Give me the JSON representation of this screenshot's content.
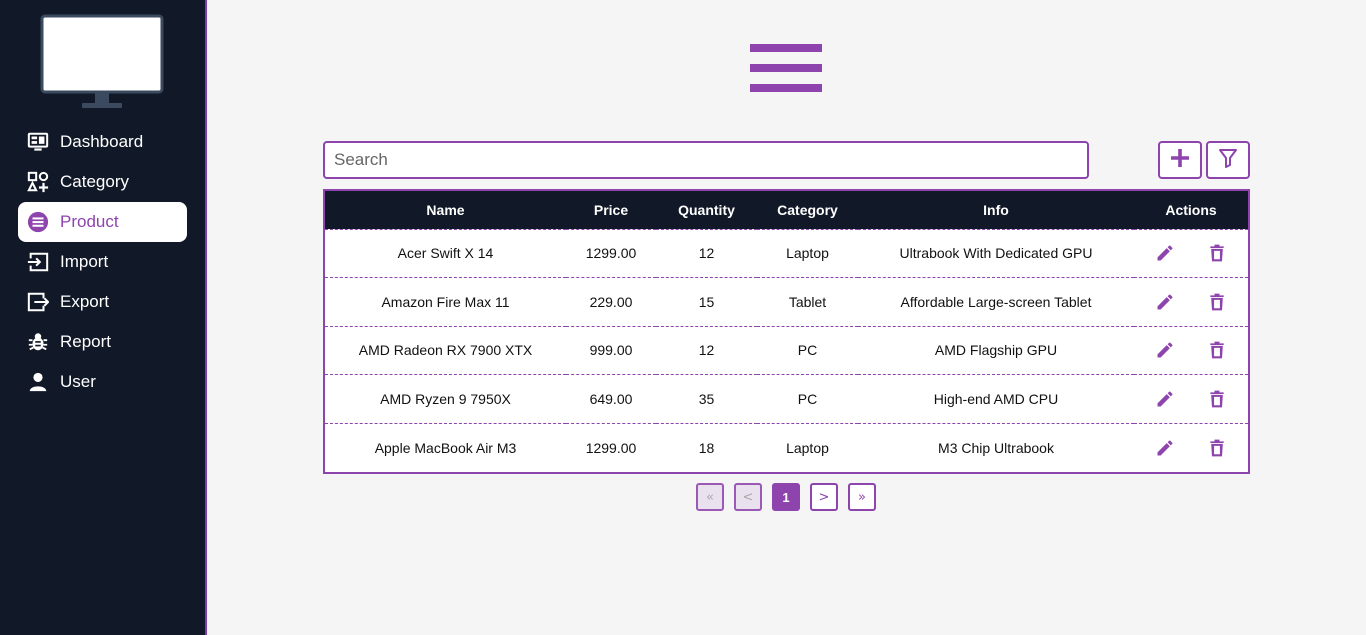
{
  "sidebar": {
    "items": [
      {
        "label": "Dashboard",
        "icon": "dashboard-icon"
      },
      {
        "label": "Category",
        "icon": "category-icon"
      },
      {
        "label": "Product",
        "icon": "product-icon",
        "active": true
      },
      {
        "label": "Import",
        "icon": "import-icon"
      },
      {
        "label": "Export",
        "icon": "export-icon"
      },
      {
        "label": "Report",
        "icon": "bug-icon"
      },
      {
        "label": "User",
        "icon": "user-icon"
      }
    ]
  },
  "search": {
    "placeholder": "Search",
    "value": ""
  },
  "table": {
    "headers": {
      "name": "Name",
      "price": "Price",
      "quantity": "Quantity",
      "category": "Category",
      "info": "Info",
      "actions": "Actions"
    },
    "rows": [
      {
        "name": "Acer Swift X 14",
        "price": "1299.00",
        "quantity": "12",
        "category": "Laptop",
        "info": "Ultrabook With Dedicated GPU"
      },
      {
        "name": "Amazon Fire Max 11",
        "price": "229.00",
        "quantity": "15",
        "category": "Tablet",
        "info": "Affordable Large-screen Tablet"
      },
      {
        "name": "AMD Radeon RX 7900 XTX",
        "price": "999.00",
        "quantity": "12",
        "category": "PC",
        "info": "AMD Flagship GPU"
      },
      {
        "name": "AMD Ryzen 9 7950X",
        "price": "649.00",
        "quantity": "35",
        "category": "PC",
        "info": "High-end AMD CPU"
      },
      {
        "name": "Apple MacBook Air M3",
        "price": "1299.00",
        "quantity": "18",
        "category": "Laptop",
        "info": "M3 Chip Ultrabook"
      }
    ]
  },
  "pagination": {
    "first": "«",
    "prev": "<",
    "current": "1",
    "next": ">",
    "last": "»"
  },
  "colors": {
    "accent": "#8e44ad",
    "sidebar_bg": "#111827",
    "page_bg": "#f5f5f5"
  }
}
